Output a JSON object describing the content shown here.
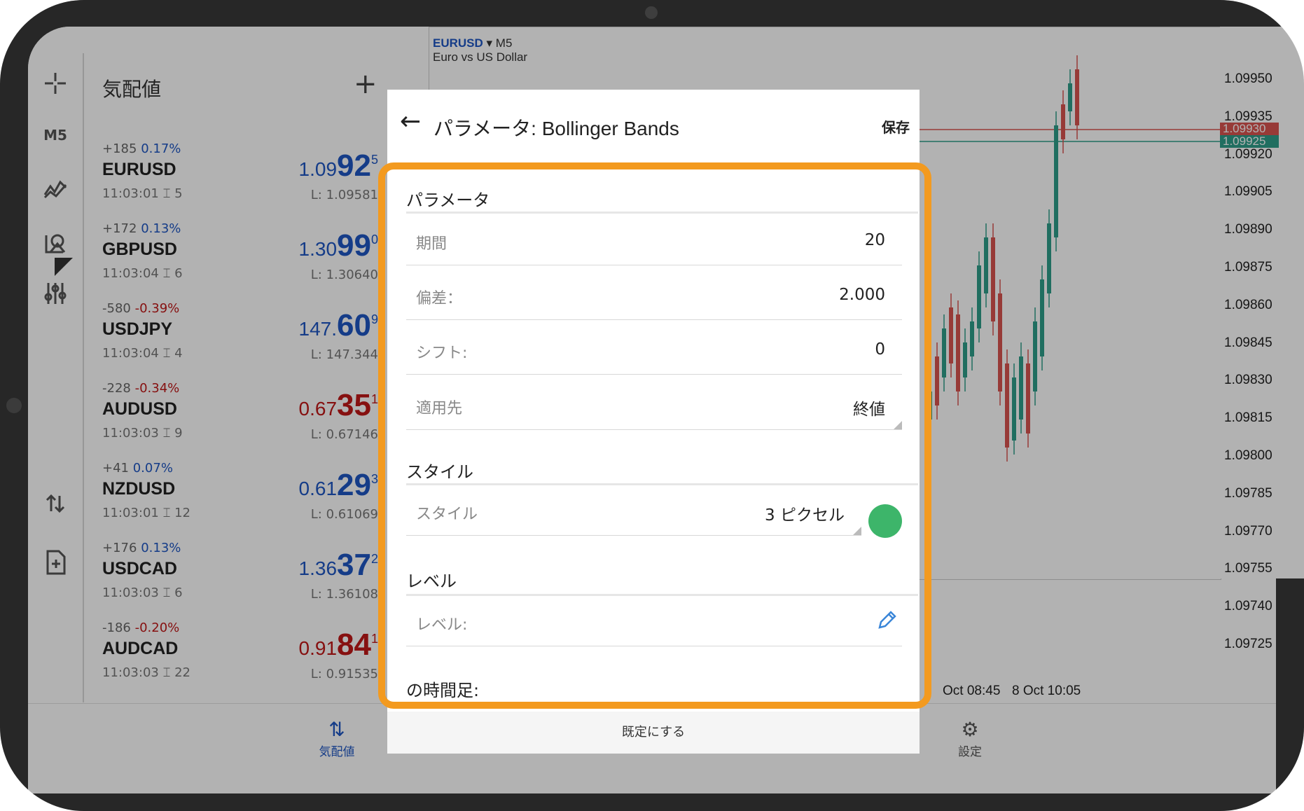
{
  "toolbar": {
    "timeframe": "M5"
  },
  "quotes": {
    "title": "気配値",
    "rows": [
      {
        "change": "+185",
        "pct": "0.17%",
        "symbol": "EURUSD",
        "time": "11:03:01 ⌶ 5",
        "bid_small": "1.09",
        "bid_big": "92",
        "bid_sup": "5",
        "low": "L: 1.09581",
        "dir": "up"
      },
      {
        "change": "+172",
        "pct": "0.13%",
        "symbol": "GBPUSD",
        "time": "11:03:04 ⌶ 6",
        "bid_small": "1.30",
        "bid_big": "99",
        "bid_sup": "0",
        "low": "L: 1.30640",
        "dir": "up"
      },
      {
        "change": "-580",
        "pct": "-0.39%",
        "symbol": "USDJPY",
        "time": "11:03:04 ⌶ 4",
        "bid_small": "147.",
        "bid_big": "60",
        "bid_sup": "9",
        "low": "L: 147.344",
        "dir": "up"
      },
      {
        "change": "-228",
        "pct": "-0.34%",
        "symbol": "AUDUSD",
        "time": "11:03:03 ⌶ 9",
        "bid_small": "0.67",
        "bid_big": "35",
        "bid_sup": "1",
        "low": "L: 0.67146",
        "dir": "down"
      },
      {
        "change": "+41",
        "pct": "0.07%",
        "symbol": "NZDUSD",
        "time": "11:03:01 ⌶ 12",
        "bid_small": "0.61",
        "bid_big": "29",
        "bid_sup": "3",
        "low": "L: 0.61069",
        "dir": "up"
      },
      {
        "change": "+176",
        "pct": "0.13%",
        "symbol": "USDCAD",
        "time": "11:03:03 ⌶ 6",
        "bid_small": "1.36",
        "bid_big": "37",
        "bid_sup": "2",
        "low": "L: 1.36108",
        "dir": "up"
      },
      {
        "change": "-186",
        "pct": "-0.20%",
        "symbol": "AUDCAD",
        "time": "11:03:03 ⌶ 22",
        "bid_small": "0.91",
        "bid_big": "84",
        "bid_sup": "1",
        "low": "L: 0.91535",
        "dir": "down"
      }
    ]
  },
  "chart": {
    "symbol": "EURUSD",
    "timeframe": "M5",
    "description": "Euro vs US Dollar",
    "price_labels": [
      "1.09950",
      "1.09935",
      "1.09920",
      "1.09905",
      "1.09890",
      "1.09875",
      "1.09860",
      "1.09845",
      "1.09830",
      "1.09815",
      "1.09800",
      "1.09785",
      "1.09770",
      "1.09755",
      "1.09740",
      "1.09725"
    ],
    "bid_tag": "1.09930",
    "ask_tag": "1.09925",
    "bid_color": "#d9534f",
    "ask_color": "#2e9e8a",
    "time_labels": [
      "Oct 08:45",
      "8 Oct 10:05"
    ]
  },
  "dialog": {
    "title": "パラメータ: Bollinger Bands",
    "save_label": "保存",
    "sections": {
      "parameters": "パラメータ",
      "style": "スタイル",
      "levels": "レベル",
      "timeframes": "の時間足:"
    },
    "fields": {
      "period_label": "期間",
      "period_value": "20",
      "deviation_label": "偏差：",
      "deviation_value": "2.000",
      "shift_label": "シフト:",
      "shift_value": "0",
      "apply_label": "適用先",
      "apply_value": "終値",
      "style_label": "スタイル",
      "style_value": "3 ピクセル",
      "style_color": "#3db56a",
      "level_label": "レベル:"
    },
    "footer_label": "既定にする"
  },
  "bottom_nav": {
    "quotes_label": "気配値",
    "settings_label": "設定"
  },
  "highlight_color": "#f39a1f"
}
